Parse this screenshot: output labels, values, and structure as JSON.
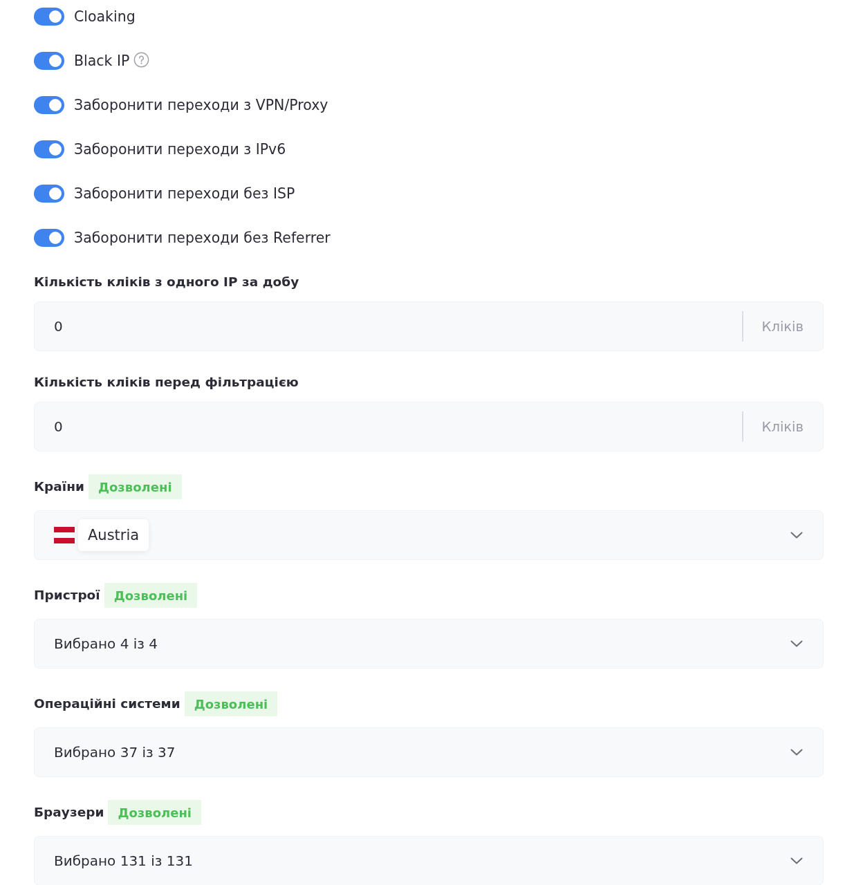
{
  "toggles": [
    {
      "label": "Cloaking",
      "on": true,
      "help": false
    },
    {
      "label": "Black IP",
      "on": true,
      "help": true
    },
    {
      "label": "Заборонити переходи з VPN/Proxy",
      "on": true,
      "help": false
    },
    {
      "label": "Заборонити переходи з IPv6",
      "on": true,
      "help": false
    },
    {
      "label": "Заборонити переходи без ISP",
      "on": true,
      "help": false
    },
    {
      "label": "Заборонити переходи без Referrer",
      "on": true,
      "help": false
    }
  ],
  "fields": [
    {
      "kind": "number",
      "label": "Кількість кліків з одного IP за добу",
      "value": "0",
      "suffix": "Кліків"
    },
    {
      "kind": "number",
      "label": "Кількість кліків перед фільтрацією",
      "value": "0",
      "suffix": "Кліків"
    },
    {
      "kind": "multiselect",
      "label": "Країни",
      "badge": "Дозволені",
      "chips": [
        {
          "label": "Austria"
        }
      ]
    },
    {
      "kind": "select",
      "label": "Пристрої",
      "badge": "Дозволені",
      "value": "Вибрано 4 із 4"
    },
    {
      "kind": "select",
      "label": "Операційні системи",
      "badge": "Дозволені",
      "value": "Вибрано 37 із 37"
    },
    {
      "kind": "select",
      "label": "Браузери",
      "badge": "Дозволені",
      "value": "Вибрано 131 із 131"
    }
  ]
}
